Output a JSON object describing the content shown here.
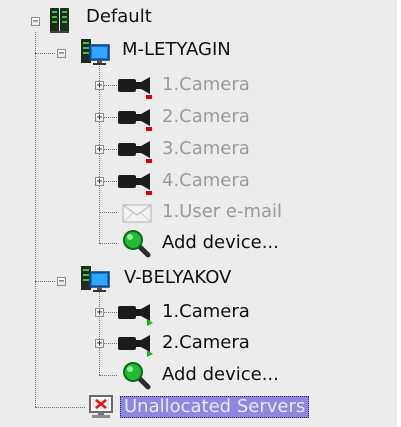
{
  "tree": {
    "root": {
      "label": "Default",
      "icon": "server-rack-icon",
      "expanded": true
    },
    "servers": [
      {
        "label": "M-LETYAGIN",
        "icon": "server-computer-icon",
        "expanded": true,
        "children": [
          {
            "label": "1.Camera",
            "icon": "camera-icon",
            "status": "disabled",
            "status_color": "#e00000"
          },
          {
            "label": "2.Camera",
            "icon": "camera-icon",
            "status": "disabled",
            "status_color": "#e00000"
          },
          {
            "label": "3.Camera",
            "icon": "camera-icon",
            "status": "disabled",
            "status_color": "#e00000"
          },
          {
            "label": "4.Camera",
            "icon": "camera-icon",
            "status": "disabled",
            "status_color": "#e00000"
          },
          {
            "label": "1.User e-mail",
            "icon": "envelope-icon",
            "status": "disabled"
          },
          {
            "label": "Add device...",
            "icon": "magnifier-add-icon"
          }
        ]
      },
      {
        "label": "V-BELYAKOV",
        "icon": "server-computer-icon",
        "expanded": true,
        "children": [
          {
            "label": "1.Camera",
            "icon": "camera-icon",
            "status": "active",
            "status_color": "#16b816"
          },
          {
            "label": "2.Camera",
            "icon": "camera-icon",
            "status": "active",
            "status_color": "#16b816"
          },
          {
            "label": "Add device...",
            "icon": "magnifier-add-icon"
          }
        ]
      }
    ],
    "unallocated": {
      "label": "Unallocated Servers",
      "icon": "server-error-icon",
      "selected": true
    }
  },
  "colors": {
    "background": "#ececec",
    "selection": "#8e86df",
    "disabled_text": "#9a9a9a"
  }
}
